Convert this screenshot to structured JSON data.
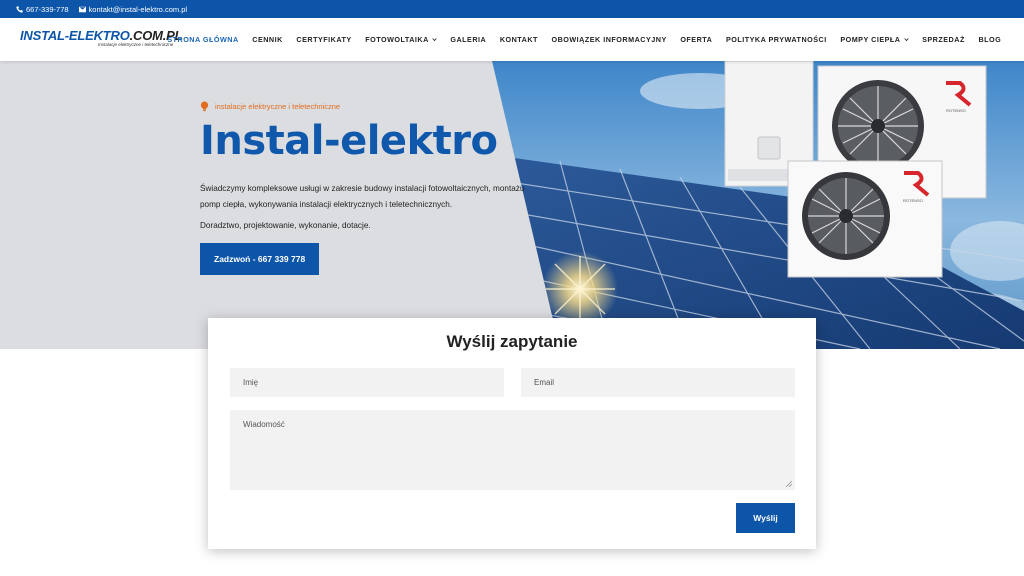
{
  "topbar": {
    "phone": "667-339-778",
    "email": "kontakt@instal-elektro.com.pl"
  },
  "logo": {
    "main": "INSTAL-ELEKTRO",
    "suffix": ".COM.PL",
    "tagline": "Instalacje elektryczne i teletechniczne"
  },
  "nav": {
    "items": [
      {
        "label": "STRONA GŁÓWNA",
        "active": true
      },
      {
        "label": "CENNIK"
      },
      {
        "label": "CERTYFIKATY"
      },
      {
        "label": "FOTOWOLTAIKA",
        "dropdown": true
      },
      {
        "label": "GALERIA"
      },
      {
        "label": "KONTAKT"
      },
      {
        "label": "OBOWIĄZEK INFORMACYJNY"
      },
      {
        "label": "OFERTA"
      },
      {
        "label": "POLITYKA PRYWATNOŚCI"
      },
      {
        "label": "POMPY CIEPŁA",
        "dropdown": true
      },
      {
        "label": "SPRZEDAŻ"
      },
      {
        "label": "BLOG"
      }
    ]
  },
  "hero": {
    "subtitle": "instalacje elektryczne i teletechniczne",
    "title": "Instal-elektro",
    "description": "Świadczymy kompleksowe usługi w zakresie budowy instalacji fotowoltaicznych, montażu pomp ciepła, wykonywania instalacji elektrycznych i teletechnicznych.",
    "description2": "Doradztwo, projektowanie, wykonanie, dotacje.",
    "cta": "Zadzwoń - 667 339 778",
    "unit_brand": "ROTENSO"
  },
  "form": {
    "title": "Wyślij zapytanie",
    "name_placeholder": "Imię",
    "email_placeholder": "Email",
    "message_placeholder": "Wiadomość",
    "submit": "Wyślij"
  },
  "colors": {
    "brand_blue": "#0d55a8",
    "accent_orange": "#e16c1d",
    "hero_bg": "#dcdde1"
  }
}
